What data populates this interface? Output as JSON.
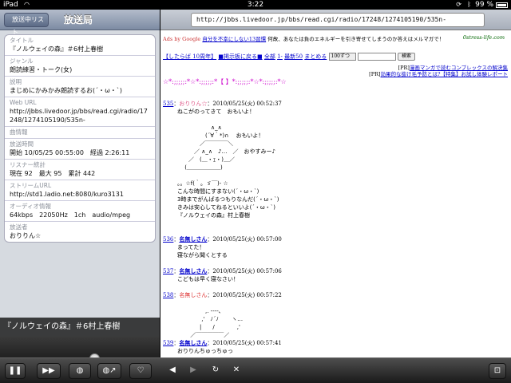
{
  "status_bar": {
    "carrier": "iPad",
    "time": "3:22",
    "battery": "99 %"
  },
  "left_pane": {
    "back_label": "放送中リスト",
    "title": "放送局",
    "fields": [
      {
        "label": "タイトル",
        "value": "『ノルウェイの森』＃6村上春樹"
      },
      {
        "label": "ジャンル",
        "value": "朗読練習・トーク(女)"
      },
      {
        "label": "説明",
        "value": "まじめにかみかみ朗読するお(´・ω・`)"
      },
      {
        "label": "Web URL",
        "value": "http://jbbs.livedoor.jp/bbs/read.cgi/radio/17248/1274105190/535n-"
      },
      {
        "label": "曲情報",
        "value": ""
      },
      {
        "label": "放送時間",
        "value": "開始 10/05/25 00:55:00　経過 2:26:11"
      },
      {
        "label": "リスナー統計",
        "value": "現在 92　最大 95　累計 442"
      },
      {
        "label": "ストリームURL",
        "value": "http://std1.ladio.net:8080/kuro3131"
      },
      {
        "label": "オーディオ情報",
        "value": "64kbps　22050Hz　1ch　audio/mpeg"
      },
      {
        "label": "放送者",
        "value": "おりりん☆"
      }
    ],
    "now_playing": "『ノルウェイの森』＃6村上春樹",
    "progress": 0.6
  },
  "toolbar": {
    "icons": [
      "pause-icon",
      "next-icon",
      "globe-icon",
      "share-icon",
      "favorite-icon",
      "back-icon",
      "forward-icon",
      "reload-icon",
      "close-icon",
      "bookmark-icon"
    ]
  },
  "browser": {
    "url": "http://jbbs.livedoor.jp/bbs/read.cgi/radio/17248/1274105190/535n-",
    "ad_label": "Ads by Google",
    "ad_link": "自分を不幸にしない13習慣",
    "ad_text": "何故、あなたは負のエネルギーを引き寄せてしまうのか答えはメルマガで！",
    "ad_site": "0stress-life.com",
    "nav_board": "【したらば 10周年】",
    "nav_back": "■掲示板に戻る■",
    "nav_all": "全部",
    "nav_range": "1-",
    "nav_latest": "最新50",
    "nav_summary": "まとめる",
    "nav_select": "100ずつ",
    "nav_search": "検索",
    "pr1_label": "[PR]",
    "pr1_link": "漫画マンガで読むコンプレックスの解決集",
    "pr2_label": "[PR]",
    "pr2_link": "効果的な抜け毛予防とは?【特集】お試し体験レポート",
    "deco_title": "☆*:;;;;;:*☆*:;;;;;:*【 】*:;;;;;:*☆*:;;;;;:*☆",
    "posts": [
      {
        "num": "535",
        "sep": "：",
        "name": "おりりん☆",
        "date": "：2010/05/25(火) 00:52:37",
        "body": "ねこがのってきて　おもいよ！\n\n　　　　　　∧_∧\n　　　　　(´∀｀*)∩　 おもいよ！\n　　　　／￣￣￣￣＼\n　　　／ ∧_∧　♪…　／　おやすみー♪\n　　／　(＿・ｪ・)＿／\n　 (＿＿＿＿＿＿)\n\n。。☆f(｀。ゞ￣)- ☆\nこんな時間にすまない(´・ω・`)\n3時までがんばるつもりなんだ(´・ω・`)\nきみは安心してねるといいよ(´・ω・`)\n『ノルウェイの森』村上春樹"
      },
      {
        "num": "536",
        "sep": "：",
        "name": "名無しさん",
        "date": "：2010/05/25(火) 00:57:00",
        "body": "まってた！\n寝ながら聞くとする"
      },
      {
        "num": "537",
        "sep": "：",
        "name": "名無しさん",
        "date": "：2010/05/25(火) 00:57:06",
        "body": "こどもは早く寝なさい！"
      },
      {
        "num": "538",
        "sep": "：",
        "name": "名無しさん",
        "date": "：2010/05/25(火) 00:57:22",
        "body": "\n　　　　　,. -‐‐-､\n　　　　 ,'　ﾉ´ﾉ　　 ヽ…\n　　　　|　　/　　　　,'\n　　 ／￣￣￣￣￣／"
      },
      {
        "num": "539",
        "sep": "：",
        "name": "名無しさん",
        "date": "：2010/05/25(火) 00:57:41",
        "body": "おりりんちゅっちゅっ"
      }
    ]
  }
}
